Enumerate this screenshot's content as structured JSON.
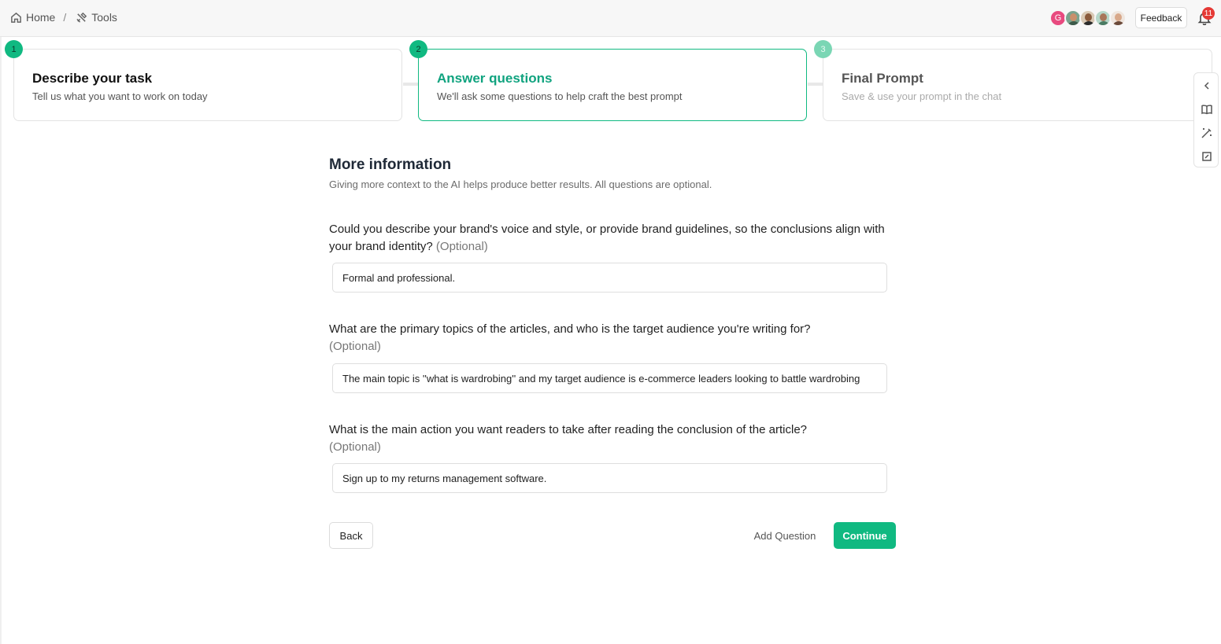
{
  "breadcrumb": {
    "home_label": "Home",
    "separator": "/",
    "tools_label": "Tools"
  },
  "header": {
    "avatar_initial": "G",
    "feedback_label": "Feedback",
    "notification_count": "11"
  },
  "steps": [
    {
      "number": "1",
      "title": "Describe your task",
      "subtitle": "Tell us what you want to work on today"
    },
    {
      "number": "2",
      "title": "Answer questions",
      "subtitle": "We'll ask some questions to help craft the best prompt"
    },
    {
      "number": "3",
      "title": "Final Prompt",
      "subtitle": "Save & use your prompt in the chat"
    }
  ],
  "form": {
    "title": "More information",
    "intro": "Giving more context to the AI helps produce better results. All questions are optional.",
    "optional_label": "(Optional)",
    "questions": [
      {
        "text": "Could you describe your brand's voice and style, or provide brand guidelines, so the conclusions align with your brand identity?",
        "answer": "Formal and professional."
      },
      {
        "text": "What are the primary topics of the articles, and who is the target audience you're writing for?",
        "answer": "The main topic is ''what is wardrobing'' and my target audience is e-commerce leaders looking to battle wardrobing"
      },
      {
        "text": "What is the main action you want readers to take after reading the conclusion of the article?",
        "answer": "Sign up to my returns management software."
      }
    ]
  },
  "actions": {
    "back_label": "Back",
    "add_question_label": "Add Question",
    "continue_label": "Continue"
  },
  "colors": {
    "accent": "#10b981",
    "badge": "#e53935"
  },
  "icons": [
    "home-icon",
    "tools-icon",
    "bell-icon",
    "chevron-left-icon",
    "book-icon",
    "magic-wand-icon",
    "edit-icon"
  ]
}
